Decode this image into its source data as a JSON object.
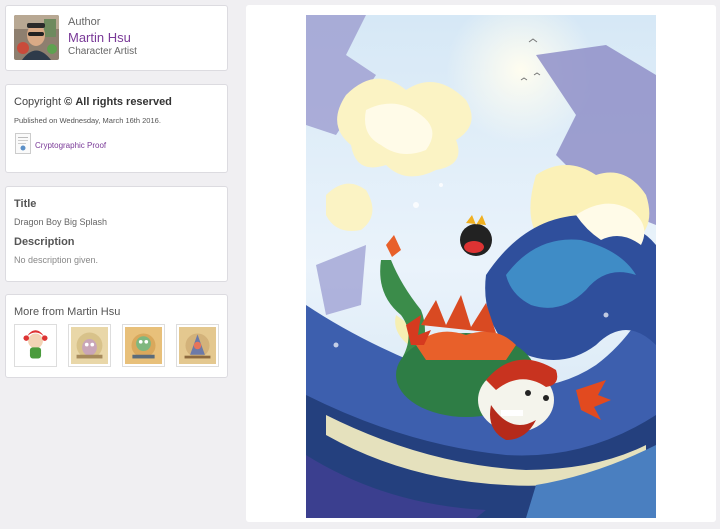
{
  "author": {
    "caption": "Author",
    "name": "Martin Hsu",
    "role": "Character Artist"
  },
  "copyright": {
    "label": "Copyright",
    "symbol": "©",
    "rights": "All rights reserved",
    "published": "Published on Wednesday, March 16th 2016.",
    "proof_link": "Cryptographic Proof"
  },
  "details": {
    "title_heading": "Title",
    "title_value": "Dragon Boy Big Splash",
    "description_heading": "Description",
    "description_value": "No description given."
  },
  "more": {
    "heading": "More from Martin Hsu",
    "thumbnails": [
      "thumbnail-1",
      "thumbnail-2",
      "thumbnail-3",
      "thumbnail-4"
    ]
  },
  "colors": {
    "link": "#7a3a98",
    "page_bg": "#f0eff2",
    "card_border": "#dcdbe0"
  }
}
